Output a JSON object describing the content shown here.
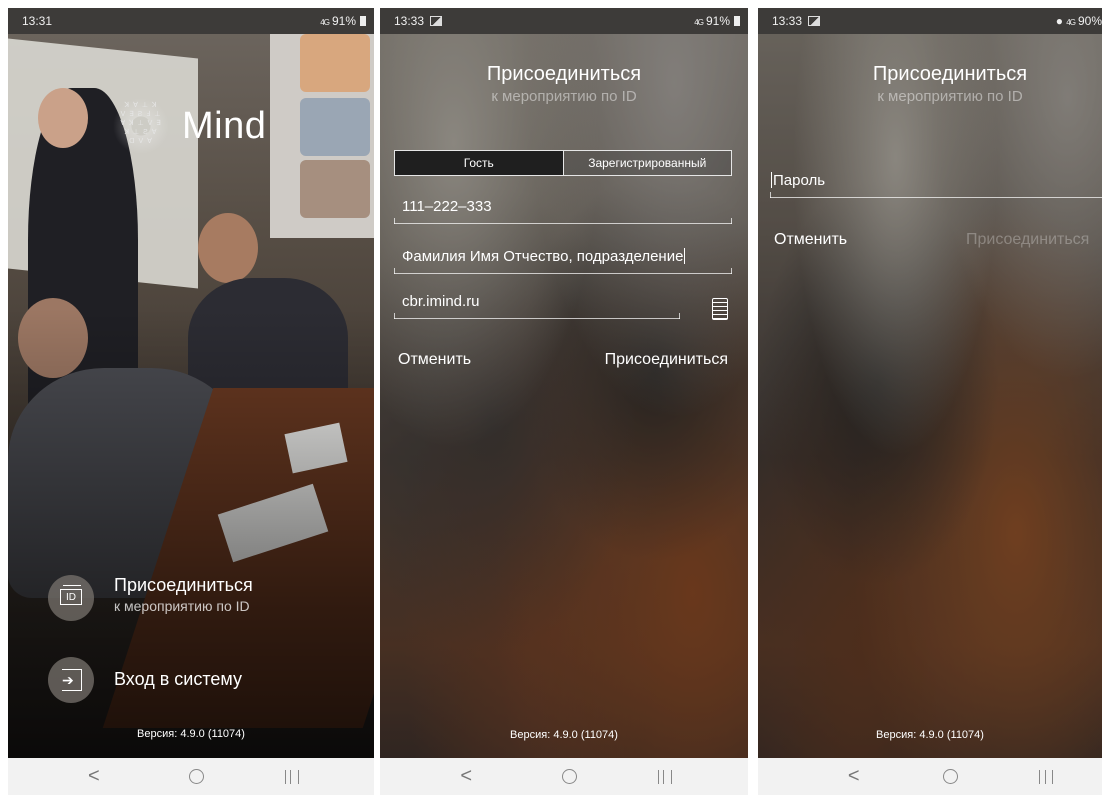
{
  "screens": [
    {
      "status": {
        "time": "13:31",
        "signal": "4G",
        "battery": "91%"
      },
      "logo_glyphs": "ꓘ ∀ ⊥ ꓘ\nV ∃ Ƨ Ⅎ ⊥\n∀ ꓘ ⊥ V ∃\nꓘ ⊥ Ƨ ∀\nᗡ V Ɐ",
      "logo": "Mind",
      "join": {
        "title": "Присоединиться",
        "subtitle": "к мероприятию по ID",
        "icon_text": "ID"
      },
      "login": {
        "title": "Вход в систему"
      },
      "version": "Версия: 4.9.0 (11074)"
    },
    {
      "status": {
        "time": "13:33",
        "signal": "4G",
        "battery": "91%"
      },
      "header": {
        "title": "Присоединиться",
        "subtitle": "к мероприятию по ID"
      },
      "tabs": [
        {
          "label": "Гость",
          "active": true
        },
        {
          "label": "Зарегистрированный",
          "active": false
        }
      ],
      "fields": {
        "meeting_id": "111–222–333",
        "name": "Фамилия Имя Отчество, подразделение",
        "server": "cbr.imind.ru"
      },
      "actions": {
        "cancel": "Отменить",
        "join": "Присоединиться"
      },
      "version": "Версия: 4.9.0 (11074)"
    },
    {
      "status": {
        "time": "13:33",
        "signal": "4G",
        "battery": "90%"
      },
      "header": {
        "title": "Присоединиться",
        "subtitle": "к мероприятию по ID"
      },
      "fields": {
        "password_placeholder": "Пароль"
      },
      "actions": {
        "cancel": "Отменить",
        "join": "Присоединиться"
      },
      "version": "Версия: 4.9.0 (11074)"
    }
  ],
  "navbar": {
    "back": "<",
    "home": "○",
    "recent": "|||"
  }
}
